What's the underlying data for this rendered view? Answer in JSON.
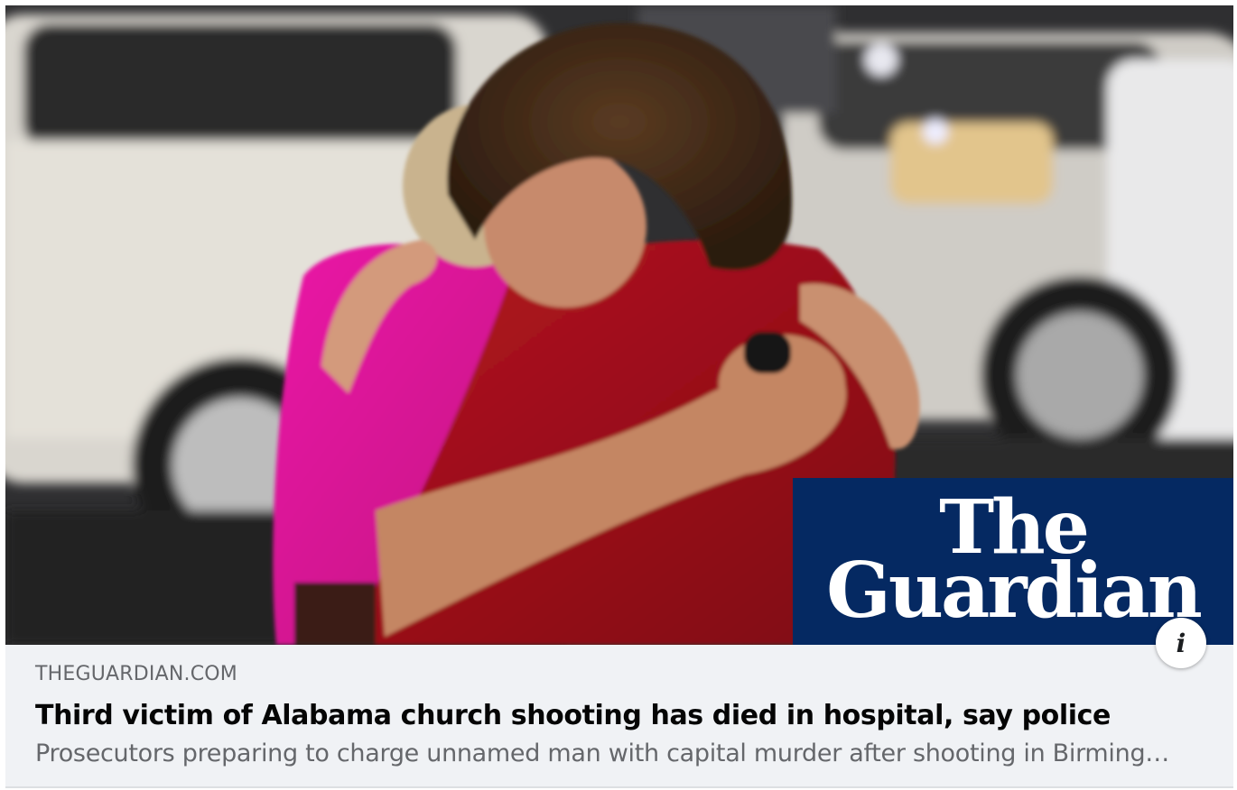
{
  "link_preview": {
    "domain": "THEGUARDIAN.COM",
    "title": "Third victim of Alabama church shooting has died in hospital, say police",
    "description": "Prosecutors preparing to charge unnamed man with capital murder after shooting in Birmingh...",
    "image": {
      "subject": "two-women-embracing-photo",
      "logo_line_1": "The",
      "logo_line_2": "Guardian"
    },
    "info_button": {
      "glyph": "i",
      "icon": "info-icon"
    }
  },
  "colors": {
    "card_background": "#f0f2f5",
    "domain_text": "#65676b",
    "title_text": "#050505",
    "guardian_blue": "#052962",
    "pink_shirt": "#e0169a",
    "red_jacket": "#a4121c"
  }
}
